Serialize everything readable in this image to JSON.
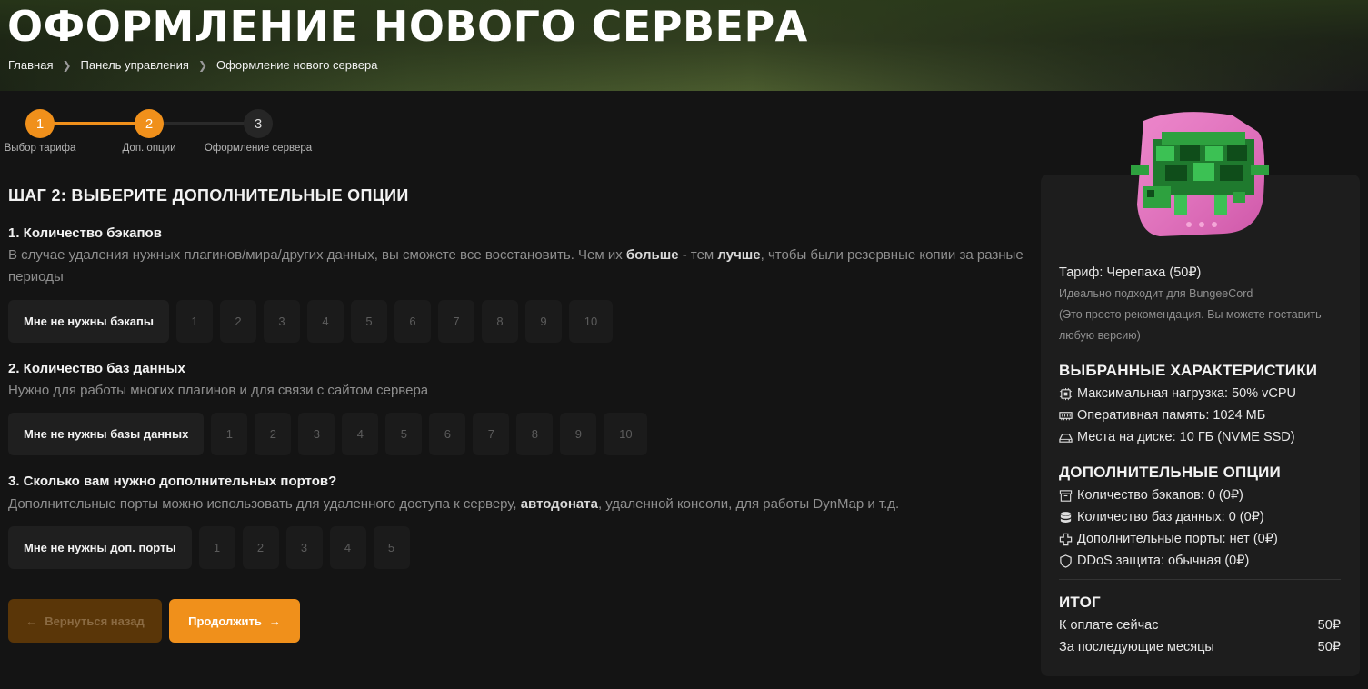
{
  "header": {
    "title": "ОФОРМЛЕНИЕ НОВОГО СЕРВЕРА",
    "breadcrumb": [
      "Главная",
      "Панель управления",
      "Оформление нового сервера"
    ]
  },
  "stepper": {
    "steps": [
      {
        "number": "1",
        "label": "Выбор тарифа"
      },
      {
        "number": "2",
        "label": "Доп. опции"
      },
      {
        "number": "3",
        "label": "Оформление сервера"
      }
    ],
    "current_step": 2
  },
  "main": {
    "section_title": "ШАГ 2: ВЫБЕРИТЕ ДОПОЛНИТЕЛЬНЫЕ ОПЦИИ",
    "backups": {
      "title": "1. Количество бэкапов",
      "desc_parts": [
        "В случае удаления нужных плагинов/мира/других данных, вы сможете все восстановить. Чем их ",
        "больше",
        " - тем ",
        "лучше",
        ", чтобы были резервные копии за разные периоды"
      ],
      "none_label": "Мне не нужны бэкапы",
      "options": [
        "1",
        "2",
        "3",
        "4",
        "5",
        "6",
        "7",
        "8",
        "9",
        "10"
      ]
    },
    "databases": {
      "title": "2. Количество баз данных",
      "desc": "Нужно для работы многих плагинов и для связи с сайтом сервера",
      "none_label": "Мне не нужны базы данных",
      "options": [
        "1",
        "2",
        "3",
        "4",
        "5",
        "6",
        "7",
        "8",
        "9",
        "10"
      ]
    },
    "ports": {
      "title": "3. Сколько вам нужно дополнительных портов?",
      "desc_parts": [
        "Дополнительные порты можно использовать для удаленного доступа к серверу, ",
        "автодоната",
        ", удаленной консоли, для работы DynMap и т.д."
      ],
      "none_label": "Мне не нужны доп. порты",
      "options": [
        "1",
        "2",
        "3",
        "4",
        "5"
      ]
    },
    "back_label": "Вернуться назад",
    "next_label": "Продолжить"
  },
  "summary": {
    "tariff": "Тариф: Черепаха (50₽)",
    "tariff_note_1": "Идеально подходит для BungeeCord",
    "tariff_note_2": "(Это просто рекомендация. Вы можете поставить любую версию)",
    "specs_title": "ВЫБРАННЫЕ ХАРАКТЕРИСТИКИ",
    "specs": [
      {
        "icon": "cpu-icon",
        "text": "Максимальная нагрузка: 50% vCPU"
      },
      {
        "icon": "ram-icon",
        "text": "Оперативная память: 1024 МБ"
      },
      {
        "icon": "disk-icon",
        "text": "Места на диске: 10 ГБ (NVME SSD)"
      }
    ],
    "extras_title": "ДОПОЛНИТЕЛЬНЫЕ ОПЦИИ",
    "extras": [
      {
        "icon": "archive-icon",
        "text": "Количество бэкапов: 0 (0₽)"
      },
      {
        "icon": "database-icon",
        "text": "Количество баз данных: 0 (0₽)"
      },
      {
        "icon": "plus-icon",
        "text": "Дополнительные порты: нет (0₽)"
      },
      {
        "icon": "shield-icon",
        "text": "DDoS защита: обычная (0₽)"
      }
    ],
    "total_title": "ИТОГ",
    "pay_now_label": "К оплате сейчас",
    "pay_now_value": "50₽",
    "monthly_label": "За последующие месяцы",
    "monthly_value": "50₽"
  },
  "colors": {
    "accent": "#f0901b",
    "background": "#141414",
    "panel": "#1d1d1d"
  }
}
